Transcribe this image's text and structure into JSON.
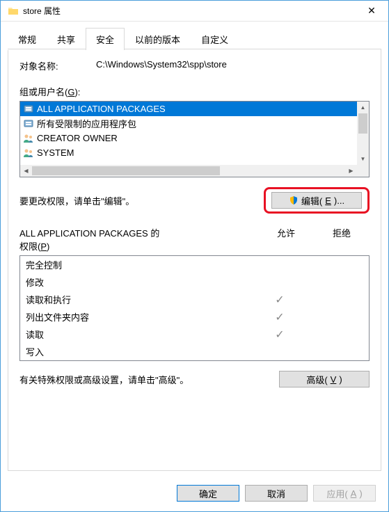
{
  "window": {
    "title": "store 属性",
    "close": "✕"
  },
  "tabs": {
    "general": "常规",
    "share": "共享",
    "security": "安全",
    "previous": "以前的版本",
    "custom": "自定义"
  },
  "object": {
    "label": "对象名称:",
    "value": "C:\\Windows\\System32\\spp\\store"
  },
  "groups": {
    "label_pre": "组或用户名(",
    "label_accel": "G",
    "label_post": "):",
    "items": [
      {
        "name": "ALL APPLICATION PACKAGES",
        "type": "package",
        "selected": true
      },
      {
        "name": "所有受限制的应用程序包",
        "type": "package",
        "selected": false
      },
      {
        "name": "CREATOR OWNER",
        "type": "users",
        "selected": false
      },
      {
        "name": "SYSTEM",
        "type": "users",
        "selected": false
      }
    ]
  },
  "edit": {
    "text": "要更改权限，请单击\"编辑\"。",
    "button_pre": "编辑(",
    "button_accel": "E",
    "button_post": ")..."
  },
  "permissions": {
    "title_line1": "ALL APPLICATION PACKAGES 的",
    "title_line2_pre": "权限(",
    "title_line2_accel": "P",
    "title_line2_post": ")",
    "col_allow": "允许",
    "col_deny": "拒绝",
    "rows": [
      {
        "name": "完全控制",
        "allow": false,
        "deny": false
      },
      {
        "name": "修改",
        "allow": false,
        "deny": false
      },
      {
        "name": "读取和执行",
        "allow": true,
        "deny": false
      },
      {
        "name": "列出文件夹内容",
        "allow": true,
        "deny": false
      },
      {
        "name": "读取",
        "allow": true,
        "deny": false
      },
      {
        "name": "写入",
        "allow": false,
        "deny": false
      }
    ]
  },
  "advanced": {
    "text": "有关特殊权限或高级设置，请单击\"高级\"。",
    "button_pre": "高级(",
    "button_accel": "V",
    "button_post": ")"
  },
  "dialog": {
    "ok": "确定",
    "cancel": "取消",
    "apply_pre": "应用(",
    "apply_accel": "A",
    "apply_post": ")"
  },
  "check": "✓"
}
